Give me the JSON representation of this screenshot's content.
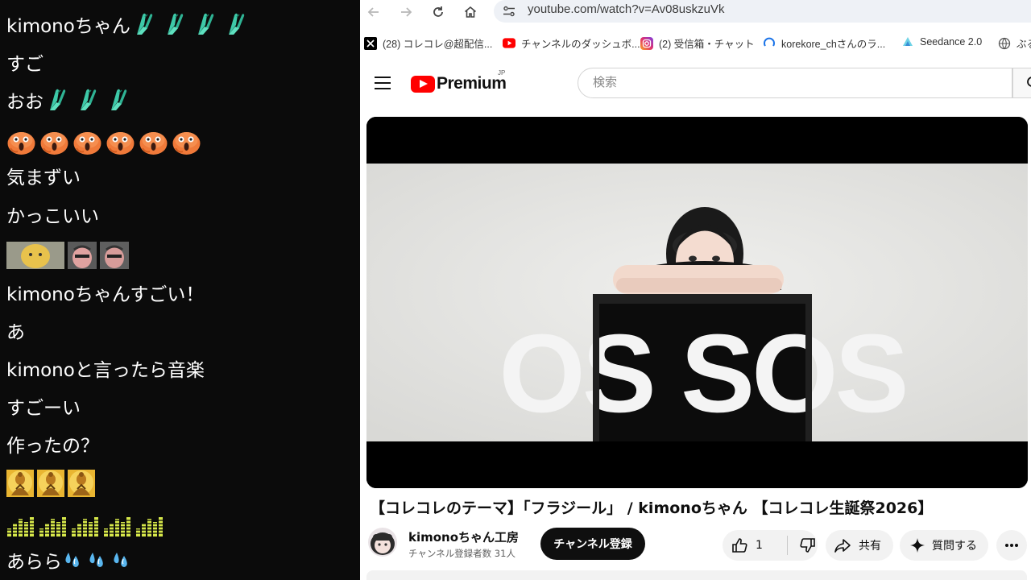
{
  "chat": {
    "messages": [
      {
        "text": "kimonoちゃん",
        "emotes": "pray",
        "count": 4
      },
      {
        "text": "すご",
        "emotes": "",
        "count": 0
      },
      {
        "text": "おお",
        "emotes": "pray",
        "count": 3
      },
      {
        "text": "",
        "emotes": "orange-face",
        "count": 6
      },
      {
        "text": "気まずい",
        "emotes": "",
        "count": 0
      },
      {
        "text": "かっこいい",
        "emotes": "",
        "count": 0
      },
      {
        "text": "",
        "emotes": "photo",
        "count": 3
      },
      {
        "text": "kimonoちゃんすごい！",
        "emotes": "",
        "count": 0
      },
      {
        "text": "あ",
        "emotes": "",
        "count": 0
      },
      {
        "text": "kimonoと言ったら音楽",
        "emotes": "",
        "count": 0
      },
      {
        "text": "すごーい",
        "emotes": "",
        "count": 0
      },
      {
        "text": "作ったの？",
        "emotes": "",
        "count": 0
      },
      {
        "text": "",
        "emotes": "buddha",
        "count": 3
      },
      {
        "text": "",
        "emotes": "equalizer",
        "count": 5
      },
      {
        "text": "あらら",
        "emotes": "sweat-drops",
        "count": 3
      }
    ]
  },
  "browser": {
    "url": "youtube.com/watch?v=Av08uskzuVk",
    "nav_icons": [
      "back-arrow-icon",
      "forward-arrow-icon",
      "reload-icon",
      "home-icon",
      "site-settings-icon"
    ],
    "bookmarks": [
      {
        "label": "(28) コレコレ@超配信...",
        "icon": "x-icon"
      },
      {
        "label": "チャンネルのダッシュボ...",
        "icon": "youtube-icon"
      },
      {
        "label": "(2) 受信箱・チャット",
        "icon": "instagram-icon"
      },
      {
        "label": "korekore_chさんのラ...",
        "icon": "loading-icon"
      },
      {
        "label": "Seedance 2.0",
        "icon": "seedance-icon"
      },
      {
        "label": "ぶる",
        "icon": "globe-icon"
      }
    ]
  },
  "youtube": {
    "logo_text": "Premium",
    "logo_region": "JP",
    "search_placeholder": "検索",
    "video": {
      "box_text": "OS SOS",
      "title": "【コレコレのテーマ】「フラジール」 / kimonoちゃん 【コレコレ生誕祭2026】"
    },
    "channel": {
      "name": "kimonoちゃん工房",
      "subscribers": "チャンネル登録者数 31人",
      "subscribe_label": "チャンネル登録"
    },
    "actions": {
      "like_count": "1",
      "share_label": "共有",
      "ask_label": "質問する"
    },
    "colors": {
      "brand": "#ff0000",
      "subscribe_bg": "#0f0f0f"
    }
  }
}
